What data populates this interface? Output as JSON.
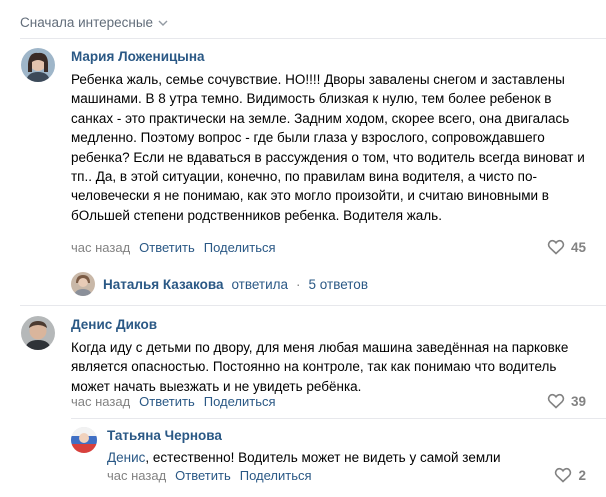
{
  "sort": {
    "label": "Сначала интересные"
  },
  "comments": [
    {
      "author": "Мария Ложеницына",
      "text": "Ребенка жаль, семье сочувствие. НО!!!! Дворы завалены снегом и заставлены машинами. В 8 утра темно. Видимость близкая к нулю, тем более ребенок в санках - это практически на земле. Задним ходом, скорее всего, она двигалась медленно. Поэтому вопрос - где были глаза у взрослого, сопровождавшего ребенка? Если не вдаваться в рассуждения о том, что водитель всегда виноват и тп.. Да, в этой ситуации, конечно, по правилам вина водителя, а чисто по-человечески я не понимаю, как это могло произойти, и считаю виновными в бОльшей степени родственников ребенка. Водителя жаль.",
      "time": "час назад",
      "reply": "Ответить",
      "share": "Поделиться",
      "likes": "45",
      "thread": {
        "name": "Наталья Казакова",
        "verb": "ответила",
        "dot": "·",
        "count": "5 ответов"
      }
    },
    {
      "author": "Денис Диков",
      "text": "Когда иду с детьми по двору, для меня любая машина заведённая на парковке является опасностью. Постоянно на контроле, так как понимаю что водитель может начать выезжать и не увидеть ребёнка.",
      "time": "час назад",
      "reply": "Ответить",
      "share": "Поделиться",
      "likes": "39"
    },
    {
      "author": "Татьяна Чернова",
      "mention": "Денис",
      "text": ", естественно! Водитель может не видеть у самой земли",
      "time": "час назад",
      "reply": "Ответить",
      "share": "Поделиться",
      "likes": "2"
    }
  ],
  "colors": {
    "link": "#2a5885",
    "muted": "#828282",
    "separator": "#e7e8ec"
  },
  "icons": {
    "sort": "chevron-down-icon",
    "like": "heart-icon"
  }
}
